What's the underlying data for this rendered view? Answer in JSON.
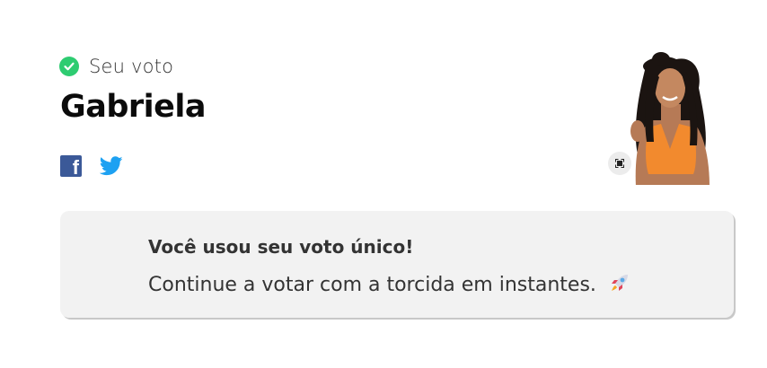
{
  "vote": {
    "label": "Seu voto",
    "candidate_name": "Gabriela",
    "status_icon": "check-circle-icon",
    "status_color": "#2ecc71"
  },
  "share": {
    "facebook_glyph": "f",
    "facebook_color": "#3b5998",
    "twitter_color": "#1da1f2"
  },
  "photo": {
    "expand_icon": "expand-icon"
  },
  "notice": {
    "title": "Você usou seu voto único!",
    "text": "Continue a votar com a torcida em instantes.",
    "icon": "rocket-icon"
  }
}
